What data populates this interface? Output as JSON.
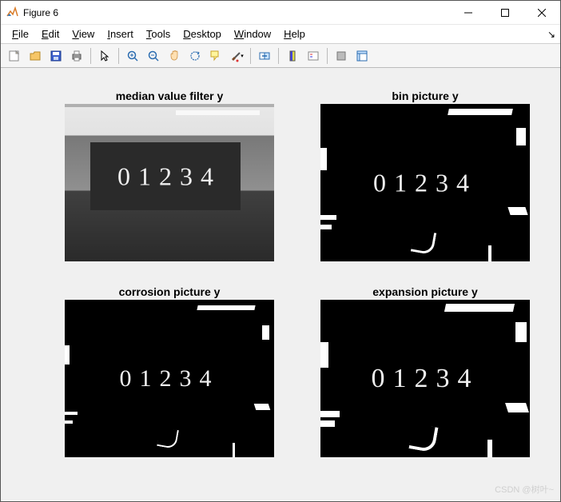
{
  "window": {
    "title": "Figure 6"
  },
  "menu": {
    "file": "File",
    "edit": "Edit",
    "view": "View",
    "insert": "Insert",
    "tools": "Tools",
    "desktop": "Desktop",
    "window": "Window",
    "help": "Help"
  },
  "toolbar": {
    "new": "New Figure",
    "open": "Open",
    "save": "Save",
    "print": "Print",
    "pointer": "Edit Plot",
    "zoom_in": "Zoom In",
    "zoom_out": "Zoom Out",
    "pan": "Pan",
    "rotate": "Rotate 3D",
    "datatip": "Data Cursor",
    "brush": "Brush",
    "link": "Link Plot",
    "colorbar": "Insert Colorbar",
    "legend": "Insert Legend",
    "hide": "Hide Plot Tools",
    "show": "Show Plot Tools"
  },
  "subplots": {
    "tl_title": "median value filter y",
    "tr_title": "bin picture y",
    "bl_title": "corrosion picture y",
    "br_title": "expansion picture y",
    "digits": "01234"
  },
  "watermark": "CSDN @树叶~"
}
